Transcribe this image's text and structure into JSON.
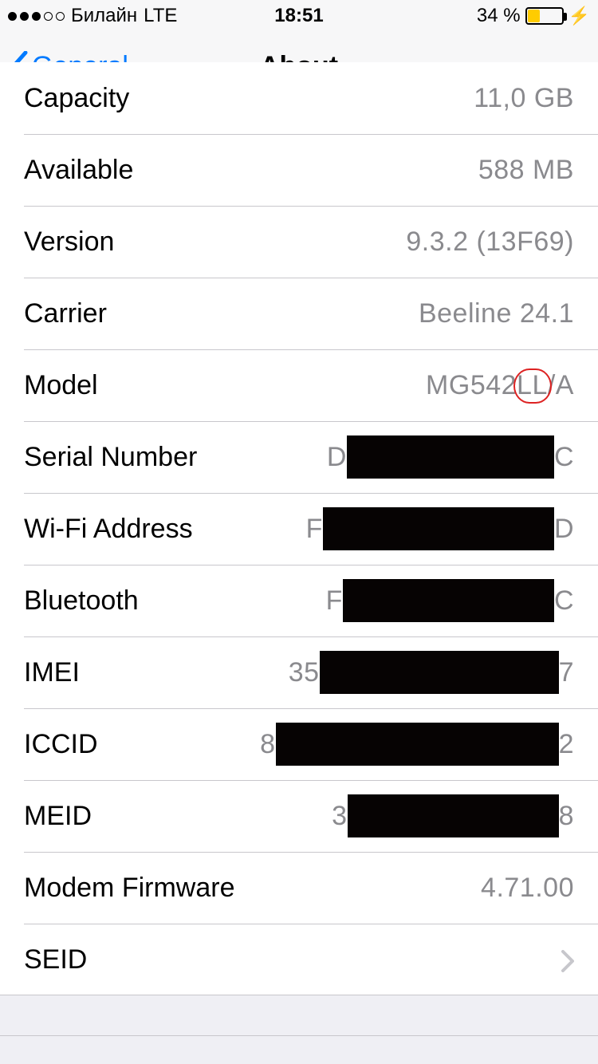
{
  "status": {
    "carrier": "Билайн",
    "network": "LTE",
    "time": "18:51",
    "battery_text": "34 %"
  },
  "nav": {
    "back_label": "General",
    "title": "About"
  },
  "rows": {
    "capacity": {
      "label": "Capacity",
      "value": "11,0 GB"
    },
    "available": {
      "label": "Available",
      "value": "588 MB"
    },
    "version": {
      "label": "Version",
      "value": "9.3.2 (13F69)"
    },
    "carrier": {
      "label": "Carrier",
      "value": "Beeline 24.1"
    },
    "model": {
      "label": "Model",
      "value": "MG542LL/A"
    },
    "serial": {
      "label": "Serial Number",
      "prefix": "D",
      "suffix": "C"
    },
    "wifi": {
      "label": "Wi-Fi Address",
      "prefix": "F",
      "suffix": "D"
    },
    "bt": {
      "label": "Bluetooth",
      "prefix": "F",
      "suffix": "C"
    },
    "imei": {
      "label": "IMEI",
      "prefix": "35",
      "suffix": "7"
    },
    "iccid": {
      "label": "ICCID",
      "prefix": "8",
      "suffix": "2"
    },
    "meid": {
      "label": "MEID",
      "prefix": "3",
      "suffix": "8"
    },
    "modem": {
      "label": "Modem Firmware",
      "value": "4.71.00"
    },
    "seid": {
      "label": "SEID"
    }
  }
}
